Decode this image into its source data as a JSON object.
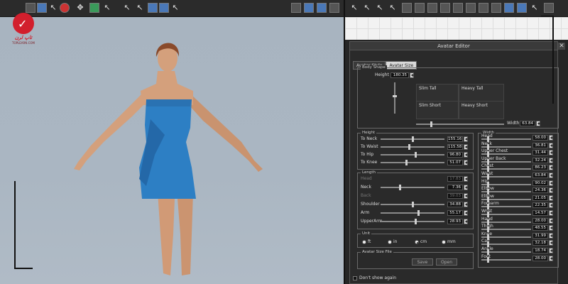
{
  "logo": {
    "text": "تاپ لرن",
    "sub": "TOPLEARN.COM"
  },
  "editor": {
    "title": "Avatar Editor",
    "tabs": [
      "Avatar Style",
      "Avatar Size"
    ],
    "body_shape": {
      "label": "Body Shape",
      "height_label": "Height",
      "height_value": "180.35",
      "width_label": "Width",
      "width_value": "63.84",
      "grid": [
        "Slim Tall",
        "Heavy Tall",
        "Slim Short",
        "Heavy Short"
      ]
    },
    "height_group": {
      "label": "Height",
      "rows": [
        {
          "name": "To Neck",
          "value": "155.16",
          "pos": 0.5
        },
        {
          "name": "To Waist",
          "value": "115.58",
          "pos": 0.45
        },
        {
          "name": "To Hip",
          "value": "96.80",
          "pos": 0.55
        },
        {
          "name": "To Knee",
          "value": "51.07",
          "pos": 0.4
        }
      ]
    },
    "length_group": {
      "label": "Length",
      "rows": [
        {
          "name": "Head",
          "value": "17.83",
          "dim": true,
          "pos": 0
        },
        {
          "name": "Neck",
          "value": "7.36",
          "dim": false,
          "pos": 0.3
        },
        {
          "name": "Back",
          "value": "39.03",
          "dim": true,
          "pos": 0
        },
        {
          "name": "Shoulder",
          "value": "34.88",
          "dim": false,
          "pos": 0.5
        },
        {
          "name": "Arm",
          "value": "55.17",
          "dim": false,
          "pos": 0.6
        },
        {
          "name": "UpperArm",
          "value": "28.93",
          "dim": false,
          "pos": 0.55
        }
      ]
    },
    "width_group": {
      "label": "Width",
      "rows": [
        {
          "name": "Head",
          "value": "58.00",
          "pos": 0.12
        },
        {
          "name": "Neck",
          "value": "36.81",
          "pos": 0.12
        },
        {
          "name": "Upper Chest",
          "value": "31.44",
          "pos": 0.12
        },
        {
          "name": "Upper Back",
          "value": "32.24",
          "pos": 0.12
        },
        {
          "name": "Chest",
          "value": "86.23",
          "pos": 0.12
        },
        {
          "name": "Waist",
          "value": "63.84",
          "pos": 0.12
        },
        {
          "name": "Hip",
          "value": "90.02",
          "pos": 0.12
        },
        {
          "name": "Elbow",
          "value": "24.36",
          "pos": 0.12
        },
        {
          "name": "Elbow",
          "value": "21.05",
          "pos": 0.12
        },
        {
          "name": "Forearm",
          "value": "22.35",
          "pos": 0.12
        },
        {
          "name": "Wrist",
          "value": "14.57",
          "pos": 0.12
        },
        {
          "name": "Hand",
          "value": "28.00",
          "pos": 0.12
        },
        {
          "name": "Thigh",
          "value": "48.55",
          "pos": 0.12
        },
        {
          "name": "Knee",
          "value": "31.99",
          "pos": 0.12
        },
        {
          "name": "Calf",
          "value": "32.18",
          "pos": 0.12
        },
        {
          "name": "Ankle",
          "value": "18.74",
          "pos": 0.12
        },
        {
          "name": "Foot",
          "value": "28.00",
          "pos": 0.12
        }
      ]
    },
    "unit": {
      "label": "Unit",
      "options": [
        "ft",
        "in",
        "cm",
        "mm"
      ],
      "selected": "cm"
    },
    "size_file": {
      "label": "Avatar Size File",
      "save": "Save",
      "open": "Open"
    },
    "dont_show": "Don't show again"
  },
  "colors": {
    "dress": "#2d7fc4",
    "skin": "#d4a07c",
    "accent": "#d21f2d"
  }
}
